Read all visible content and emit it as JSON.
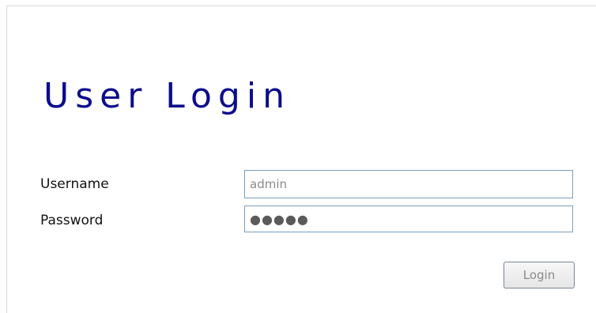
{
  "login": {
    "title": "User Login",
    "username_label": "Username",
    "username_value": "admin",
    "password_label": "Password",
    "password_value": "●●●●●",
    "button_label": "Login"
  }
}
